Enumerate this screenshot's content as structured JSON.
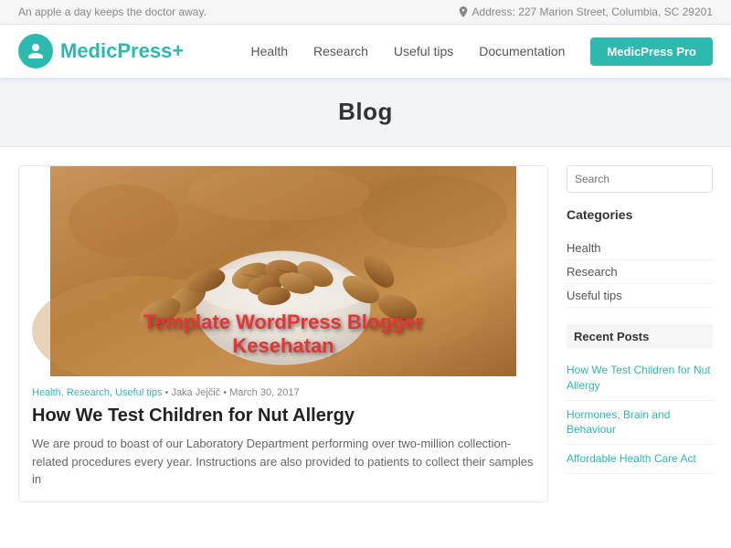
{
  "topbar": {
    "tagline": "An apple a day keeps the doctor away.",
    "address_icon": "📍",
    "address": "Address: 227 Marion Street, Columbia, SC 29201"
  },
  "header": {
    "logo_text": "Medic",
    "logo_accent": "Press",
    "logo_plus": "+",
    "nav": {
      "items": [
        {
          "label": "Health",
          "href": "#"
        },
        {
          "label": "Research",
          "href": "#"
        },
        {
          "label": "Useful tips",
          "href": "#"
        },
        {
          "label": "Documentation",
          "href": "#"
        }
      ],
      "cta_label": "MedicPress Pro"
    }
  },
  "blog_header": {
    "title": "Blog"
  },
  "article": {
    "overlay_line1": "Template WordPress Blogger",
    "overlay_line2": "Kesehatan",
    "meta_tags": "Health, Research, Useful tips",
    "meta_author": "Jaka Jejčič",
    "meta_date": "March 30, 2017",
    "title": "How We Test Children for Nut Allergy",
    "excerpt": "We are proud to boast of our Laboratory Department performing over two-million collection-related procedures every year. Instructions are also provided to patients to collect their samples in"
  },
  "sidebar": {
    "search_placeholder": "Search",
    "search_icon": "🔍",
    "categories_title": "Categories",
    "categories": [
      {
        "label": "Health"
      },
      {
        "label": "Research"
      },
      {
        "label": "Useful tips"
      }
    ],
    "recent_posts_title": "Recent Posts",
    "recent_posts": [
      {
        "label": "How We Test Children for Nut Allergy"
      },
      {
        "label": "Hormones, Brain and Behaviour"
      },
      {
        "label": "Affordable Health Care Act"
      }
    ]
  }
}
